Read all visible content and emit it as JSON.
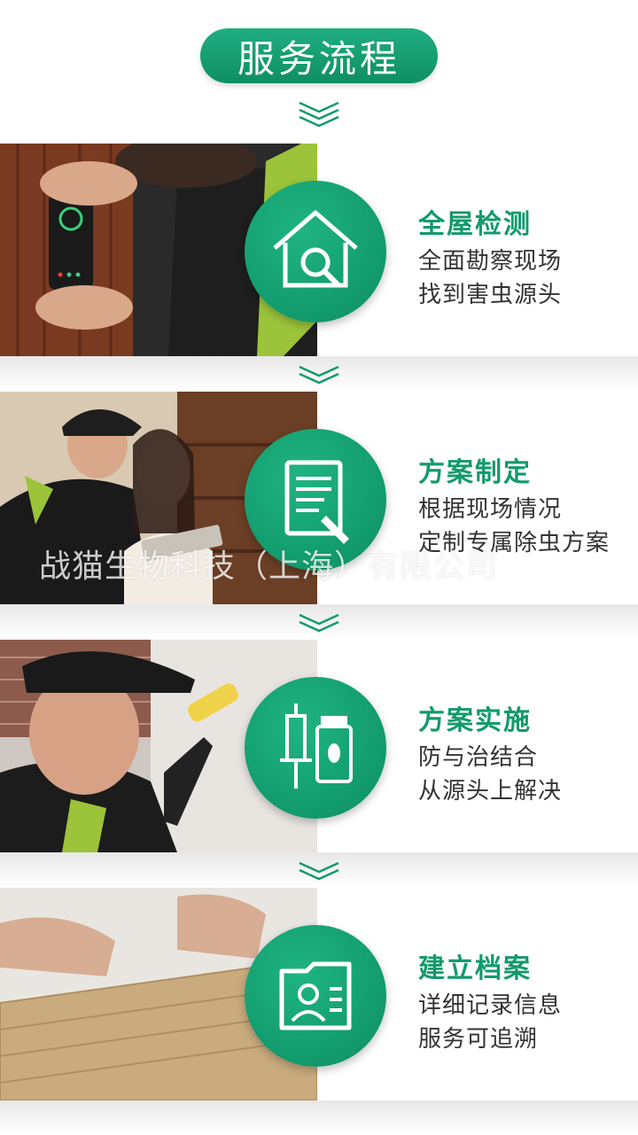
{
  "header": {
    "title": "服务流程"
  },
  "steps": [
    {
      "title": "全屋检测",
      "line1": "全面勘察现场",
      "line2": "找到害虫源头",
      "icon": "house-magnifier-icon"
    },
    {
      "title": "方案制定",
      "line1": "根据现场情况",
      "line2": "定制专属除虫方案",
      "icon": "document-pen-icon"
    },
    {
      "title": "方案实施",
      "line1": "防与治结合",
      "line2": "从源头上解决",
      "icon": "syringe-bottle-icon"
    },
    {
      "title": "建立档案",
      "line1": "详细记录信息",
      "line2": "服务可追溯",
      "icon": "profile-folder-icon"
    }
  ],
  "watermark": "战猫生物科技（上海）有限公司",
  "colors": {
    "accent": "#129a6c",
    "text": "#333333"
  }
}
